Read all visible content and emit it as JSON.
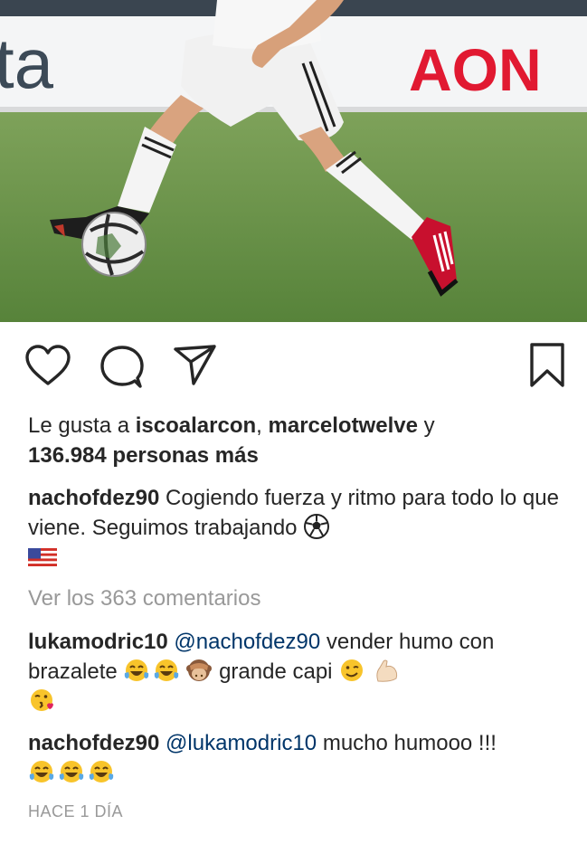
{
  "photo": {
    "banner_left_text": "ta",
    "banner_right_text": "AON",
    "colors": {
      "pitch": "#5f8a3a",
      "banner": "#ffffff",
      "aon_red": "#e11931"
    }
  },
  "actions": [
    "heart-icon",
    "comment-icon",
    "share-icon",
    "bookmark-icon"
  ],
  "likes": {
    "prefix": "Le gusta a ",
    "user1": "iscoalarcon",
    "sep": ", ",
    "user2": "marcelotwelve",
    "and": " y",
    "count_text": "136.984 personas más"
  },
  "caption": {
    "username": "nachofdez90",
    "text": " Cogiendo fuerza y ritmo para todo lo que viene. Seguimos trabajando "
  },
  "view_comments": "Ver los 363 comentarios",
  "comments": [
    {
      "username": "lukamodric10",
      "mention": "@nachofdez90",
      "text_a": " vender humo con brazalete ",
      "text_b": " grande capi "
    },
    {
      "username": "nachofdez90",
      "mention": "@lukamodric10",
      "text_a": " mucho humooo !!! "
    }
  ],
  "timestamp": "HACE 1 DÍA"
}
